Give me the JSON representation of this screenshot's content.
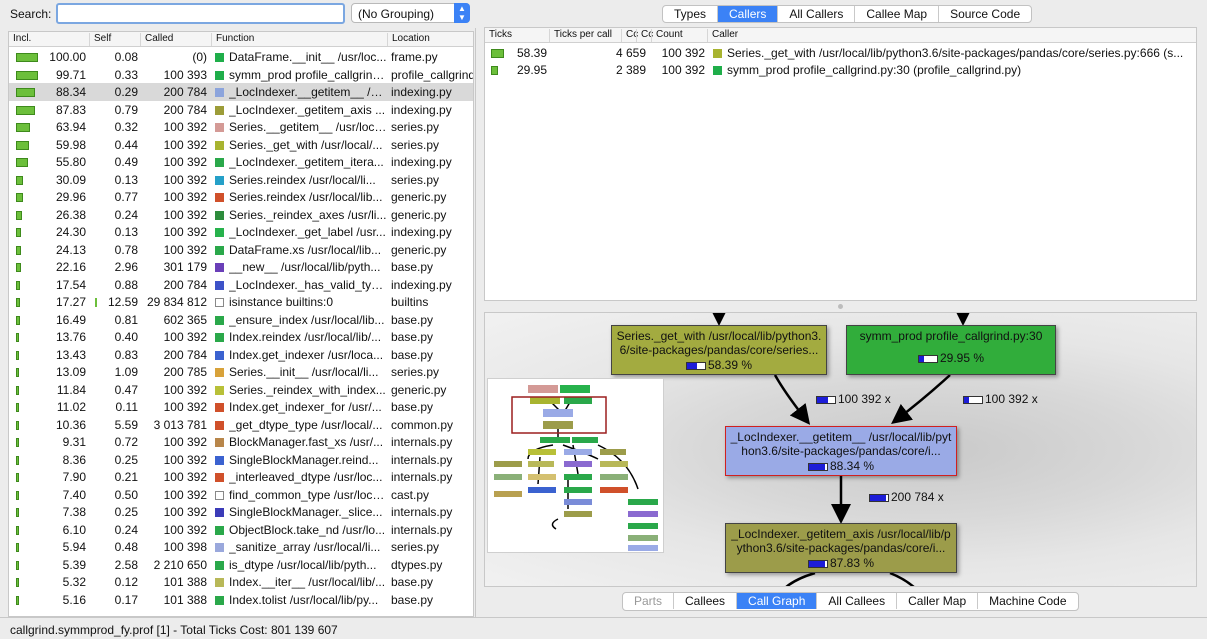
{
  "search": {
    "label": "Search:",
    "value": ""
  },
  "grouping": {
    "value": "(No Grouping)"
  },
  "function_table": {
    "columns": [
      "Incl.",
      "Self",
      "Called",
      "Function",
      "Location"
    ],
    "selected_index": 2,
    "rows": [
      {
        "incl": "100.00",
        "self": "0.08",
        "called": "(0)",
        "function": "DataFrame.__init__ /usr/loc...",
        "location": "frame.py",
        "color": "#1fae4a",
        "bar": 1.0
      },
      {
        "incl": "99.71",
        "self": "0.33",
        "called": "100 393",
        "function": "symm_prod profile_callgrind....",
        "location": "profile_callgrind",
        "color": "#1fae4a",
        "bar": 0.997
      },
      {
        "incl": "88.34",
        "self": "0.29",
        "called": "200 784",
        "function": "_LocIndexer.__getitem__ /us...",
        "location": "indexing.py",
        "color": "#8ca4dc",
        "bar": 0.883
      },
      {
        "incl": "87.83",
        "self": "0.79",
        "called": "200 784",
        "function": "_LocIndexer._getitem_axis ...",
        "location": "indexing.py",
        "color": "#9c9c38",
        "bar": 0.878
      },
      {
        "incl": "63.94",
        "self": "0.32",
        "called": "100 392",
        "function": "Series.__getitem__ /usr/loca...",
        "location": "series.py",
        "color": "#d49a96",
        "bar": 0.639
      },
      {
        "incl": "59.98",
        "self": "0.44",
        "called": "100 392",
        "function": "Series._get_with /usr/local/...",
        "location": "series.py",
        "color": "#a8b430",
        "bar": 0.6
      },
      {
        "incl": "55.80",
        "self": "0.49",
        "called": "100 392",
        "function": "_LocIndexer._getitem_itera...",
        "location": "indexing.py",
        "color": "#2aa84a",
        "bar": 0.558
      },
      {
        "incl": "30.09",
        "self": "0.13",
        "called": "100 392",
        "function": "Series.reindex /usr/local/li...",
        "location": "series.py",
        "color": "#25a0c8",
        "bar": 0.301
      },
      {
        "incl": "29.96",
        "self": "0.77",
        "called": "100 392",
        "function": "Series.reindex /usr/local/lib...",
        "location": "generic.py",
        "color": "#d0502a",
        "bar": 0.3
      },
      {
        "incl": "26.38",
        "self": "0.24",
        "called": "100 392",
        "function": "Series._reindex_axes /usr/li...",
        "location": "generic.py",
        "color": "#2d8c3c",
        "bar": 0.264
      },
      {
        "incl": "24.30",
        "self": "0.13",
        "called": "100 392",
        "function": "_LocIndexer._get_label /usr...",
        "location": "indexing.py",
        "color": "#27b24c",
        "bar": 0.243
      },
      {
        "incl": "24.13",
        "self": "0.78",
        "called": "100 392",
        "function": "DataFrame.xs /usr/local/lib...",
        "location": "generic.py",
        "color": "#2aa84a",
        "bar": 0.241
      },
      {
        "incl": "22.16",
        "self": "2.96",
        "called": "301 179",
        "function": "__new__ /usr/local/lib/pyth...",
        "location": "base.py",
        "color": "#6a3fb8",
        "bar": 0.222
      },
      {
        "incl": "17.54",
        "self": "0.88",
        "called": "200 784",
        "function": "_LocIndexer._has_valid_typ...",
        "location": "indexing.py",
        "color": "#3d52c8",
        "bar": 0.175
      },
      {
        "incl": "17.27",
        "self": "12.59",
        "called": "29 834 812",
        "function": "isinstance builtins:0",
        "location": "builtins",
        "color": "#ffffff",
        "bar": 0.173
      },
      {
        "incl": "16.49",
        "self": "0.81",
        "called": "602 365",
        "function": "_ensure_index /usr/local/lib...",
        "location": "base.py",
        "color": "#2aa84a",
        "bar": 0.165
      },
      {
        "incl": "13.76",
        "self": "0.40",
        "called": "100 392",
        "function": "Index.reindex /usr/local/lib/...",
        "location": "base.py",
        "color": "#2aa84a",
        "bar": 0.138
      },
      {
        "incl": "13.43",
        "self": "0.83",
        "called": "200 784",
        "function": "Index.get_indexer /usr/loca...",
        "location": "base.py",
        "color": "#3b62d0",
        "bar": 0.134
      },
      {
        "incl": "13.09",
        "self": "1.09",
        "called": "200 785",
        "function": "Series.__init__ /usr/local/li...",
        "location": "series.py",
        "color": "#d8a23a",
        "bar": 0.131
      },
      {
        "incl": "11.84",
        "self": "0.47",
        "called": "100 392",
        "function": "Series._reindex_with_index...",
        "location": "generic.py",
        "color": "#b8c038",
        "bar": 0.118
      },
      {
        "incl": "11.02",
        "self": "0.11",
        "called": "100 392",
        "function": "Index.get_indexer_for /usr/...",
        "location": "base.py",
        "color": "#d0502a",
        "bar": 0.11
      },
      {
        "incl": "10.36",
        "self": "5.59",
        "called": "3 013 781",
        "function": "_get_dtype_type /usr/local/...",
        "location": "common.py",
        "color": "#d0502a",
        "bar": 0.104
      },
      {
        "incl": "9.31",
        "self": "0.72",
        "called": "100 392",
        "function": "BlockManager.fast_xs /usr/...",
        "location": "internals.py",
        "color": "#b8864a",
        "bar": 0.093
      },
      {
        "incl": "8.36",
        "self": "0.25",
        "called": "100 392",
        "function": "SingleBlockManager.reind...",
        "location": "internals.py",
        "color": "#3b62d0",
        "bar": 0.084
      },
      {
        "incl": "7.90",
        "self": "0.21",
        "called": "100 392",
        "function": "_interleaved_dtype /usr/loc...",
        "location": "internals.py",
        "color": "#d0502a",
        "bar": 0.079
      },
      {
        "incl": "7.40",
        "self": "0.50",
        "called": "100 392",
        "function": "find_common_type /usr/loca...",
        "location": "cast.py",
        "color": "#ffffff",
        "bar": 0.074
      },
      {
        "incl": "7.38",
        "self": "0.25",
        "called": "100 392",
        "function": "SingleBlockManager._slice...",
        "location": "internals.py",
        "color": "#3b3bb8",
        "bar": 0.074
      },
      {
        "incl": "6.10",
        "self": "0.24",
        "called": "100 392",
        "function": "ObjectBlock.take_nd /usr/lo...",
        "location": "internals.py",
        "color": "#2aa84a",
        "bar": 0.061
      },
      {
        "incl": "5.94",
        "self": "0.48",
        "called": "100 398",
        "function": "_sanitize_array /usr/local/li...",
        "location": "series.py",
        "color": "#9aa8dc",
        "bar": 0.059
      },
      {
        "incl": "5.39",
        "self": "2.58",
        "called": "2 210 650",
        "function": "is_dtype /usr/local/lib/pyth...",
        "location": "dtypes.py",
        "color": "#2aa84a",
        "bar": 0.054
      },
      {
        "incl": "5.32",
        "self": "0.12",
        "called": "101 388",
        "function": "Index.__iter__ /usr/local/lib/...",
        "location": "base.py",
        "color": "#b8b858",
        "bar": 0.053
      },
      {
        "incl": "5.16",
        "self": "0.17",
        "called": "101 388",
        "function": "Index.tolist /usr/local/lib/py...",
        "location": "base.py",
        "color": "#2aa84a",
        "bar": 0.052
      }
    ]
  },
  "tabs_top": [
    {
      "label": "Types",
      "active": false
    },
    {
      "label": "Callers",
      "active": true
    },
    {
      "label": "All Callers",
      "active": false
    },
    {
      "label": "Callee Map",
      "active": false
    },
    {
      "label": "Source Code",
      "active": false
    }
  ],
  "callers_table": {
    "columns": [
      "Ticks",
      "Ticks per call",
      "Cc",
      "Cc",
      "Count",
      "Caller"
    ],
    "rows": [
      {
        "ticks": "58.39",
        "ticks_per_call": "4 659",
        "count": "100 392",
        "caller": "Series._get_with /usr/local/lib/python3.6/site-packages/pandas/core/series.py:666 (s...",
        "color": "#a8b430",
        "bar": 0.58
      },
      {
        "ticks": "29.95",
        "ticks_per_call": "2 389",
        "count": "100 392",
        "caller": "symm_prod profile_callgrind.py:30 (profile_callgrind.py)",
        "color": "#1fae4a",
        "bar": 0.3
      }
    ]
  },
  "call_graph": {
    "nodes": {
      "caller_a": {
        "label": "Series._get_with /usr/local/lib/python3.6/site-packages/pandas/core/series...",
        "pct": "58.39 %",
        "fill": 0.58,
        "color": "#a3ab40"
      },
      "caller_b": {
        "label": "symm_prod profile_callgrind.py:30",
        "pct": "29.95 %",
        "fill": 0.3,
        "color": "#31ad3b"
      },
      "current": {
        "label": "_LocIndexer.__getitem__ /usr/local/lib/python3.6/site-packages/pandas/core/i...",
        "pct": "88.34 %",
        "fill": 0.88,
        "color": "#9aaae6"
      },
      "callee": {
        "label": "_LocIndexer._getitem_axis /usr/local/lib/python3.6/site-packages/pandas/core/i...",
        "pct": "87.83 %",
        "fill": 0.88,
        "color": "#9c9c4a"
      }
    },
    "edges": {
      "edge_a": {
        "label": "100 392 x",
        "fill": 0.6
      },
      "edge_b": {
        "label": "100 392 x",
        "fill": 0.3
      },
      "edge_c": {
        "label": "200 784 x",
        "fill": 0.88
      }
    }
  },
  "tabs_bottom": [
    {
      "label": "Parts",
      "active": false,
      "disabled": true
    },
    {
      "label": "Callees",
      "active": false,
      "disabled": false
    },
    {
      "label": "Call Graph",
      "active": true,
      "disabled": false
    },
    {
      "label": "All Callees",
      "active": false,
      "disabled": false
    },
    {
      "label": "Caller Map",
      "active": false,
      "disabled": false
    },
    {
      "label": "Machine Code",
      "active": false,
      "disabled": false
    }
  ],
  "status": {
    "text": "callgrind.symmprod_fy.prof [1] - Total Ticks Cost: 801 139 607"
  }
}
